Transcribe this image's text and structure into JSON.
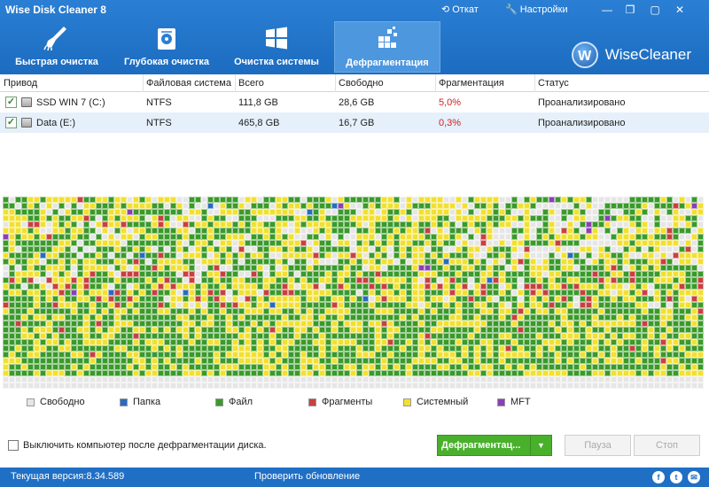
{
  "window": {
    "title": "Wise Disk Cleaner 8",
    "rollback": "Откат",
    "settings": "Настройки"
  },
  "tabs": [
    {
      "label": "Быстрая очистка",
      "icon": "broom-icon"
    },
    {
      "label": "Глубокая очистка",
      "icon": "deep-clean-icon"
    },
    {
      "label": "Очистка системы",
      "icon": "windows-icon"
    },
    {
      "label": "Дефрагментация",
      "icon": "defrag-icon",
      "active": true
    }
  ],
  "brand": {
    "logo_letter": "W",
    "name": "WiseCleaner"
  },
  "table": {
    "headers": [
      "Привод",
      "Файловая система",
      "Всего",
      "Свободно",
      "Фрагментация",
      "Статус"
    ],
    "rows": [
      {
        "drive": "SSD WIN 7 (C:)",
        "fs": "NTFS",
        "total": "111,8 GB",
        "free": "28,6 GB",
        "frag": "5,0%",
        "status": "Проанализировано",
        "checked": true
      },
      {
        "drive": "Data (E:)",
        "fs": "NTFS",
        "total": "465,8 GB",
        "free": "16,7 GB",
        "frag": "0,3%",
        "status": "Проанализировано",
        "checked": true
      }
    ]
  },
  "legend": [
    {
      "label": "Свободно",
      "color": "#e6e6e6"
    },
    {
      "label": "Папка",
      "color": "#2a6bbf"
    },
    {
      "label": "Файл",
      "color": "#3a9a2a"
    },
    {
      "label": "Фрагменты",
      "color": "#c84040"
    },
    {
      "label": "Системный",
      "color": "#f2e030"
    },
    {
      "label": "MFT",
      "color": "#8b3fb5"
    }
  ],
  "actions": {
    "shutdown_label": "Выключить компьютер после дефрагментации диска.",
    "defrag_label": "Дефрагментац...",
    "pause_label": "Пауза",
    "stop_label": "Стоп"
  },
  "status": {
    "version": "Текущая версия:8.34.589",
    "update": "Проверить обновление"
  },
  "colors": {
    "header": "#1f73c9",
    "accent_green": "#49b02c",
    "frag_red": "#d02020"
  }
}
